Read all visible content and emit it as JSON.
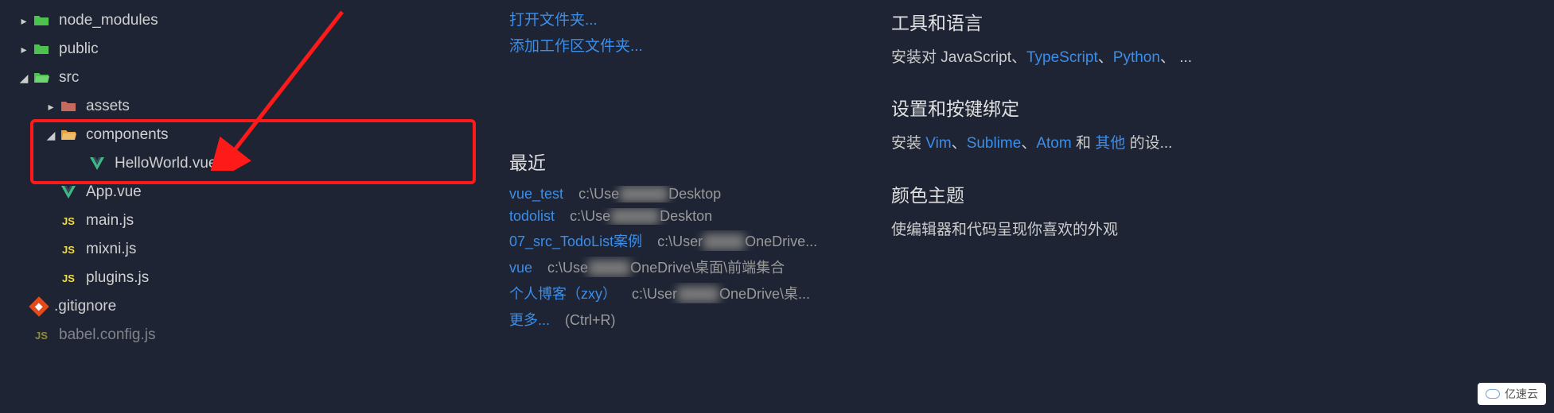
{
  "tree": {
    "node_modules": "node_modules",
    "public": "public",
    "src": "src",
    "assets": "assets",
    "components": "components",
    "helloworld": "HelloWorld.vue",
    "appvue": "App.vue",
    "mainjs": "main.js",
    "mixnijs": "mixni.js",
    "pluginsjs": "plugins.js",
    "gitignore": ".gitignore",
    "babelconfig": "babel.config.js"
  },
  "start": {
    "open_folder": "打开文件夹...",
    "add_workspace": "添加工作区文件夹..."
  },
  "recent": {
    "title": "最近",
    "items": [
      {
        "name": "vue_test",
        "path": "c:\\Use",
        "tail": "Desktop"
      },
      {
        "name": "todolist",
        "path": "c:\\Use",
        "tail": "Deskton"
      },
      {
        "name": "07_src_TodoList案例",
        "path": "c:\\User",
        "tail": "OneDrive..."
      },
      {
        "name": "vue",
        "path": "c:\\Use",
        "tail": "OneDrive\\桌面\\前端集合"
      },
      {
        "name": "个人博客（zxy）",
        "path": "c:\\User",
        "tail": "OneDrive\\桌..."
      }
    ],
    "more": "更多...",
    "more_key": "(Ctrl+R)"
  },
  "customize": {
    "tools_title": "工具和语言",
    "tools_prefix": "安装对 JavaScript、",
    "tools_links": [
      "TypeScript",
      "Python"
    ],
    "tools_suffix": "、 ...",
    "settings_title": "设置和按键绑定",
    "settings_prefix": "安装 ",
    "settings_links": [
      "Vim",
      "Sublime",
      "Atom"
    ],
    "settings_mid": " 和 ",
    "settings_other": "其他",
    "settings_suffix": " 的设...",
    "theme_title": "颜色主题",
    "theme_text": "使编辑器和代码呈现你喜欢的外观"
  },
  "watermark": "亿速云"
}
